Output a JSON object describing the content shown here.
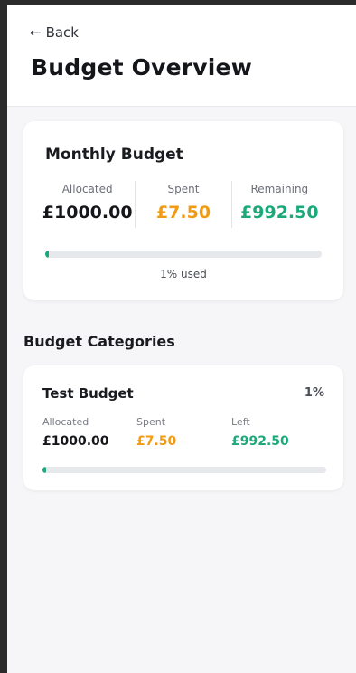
{
  "header": {
    "back_label": "Back",
    "title": "Budget Overview"
  },
  "monthly": {
    "title": "Monthly Budget",
    "stats": [
      {
        "label": "Allocated",
        "value": "£1000.00",
        "color": "#15161a"
      },
      {
        "label": "Spent",
        "value": "£7.50",
        "color": "#f19a13"
      },
      {
        "label": "Remaining",
        "value": "£992.50",
        "color": "#1ba97a"
      }
    ],
    "progress": 0.01,
    "used_text": "1% used"
  },
  "categories_section": {
    "title": "Budget Categories"
  },
  "categories": [
    {
      "name": "Test Budget",
      "percent": "1%",
      "allocated_label": "Allocated",
      "allocated_value": "£1000.00",
      "spent_label": "Spent",
      "spent_value": "£7.50",
      "left_label": "Left",
      "left_value": "£992.50",
      "progress": 0.01
    }
  ],
  "colors": {
    "accent_green": "#1ba97a",
    "accent_orange": "#f19a13",
    "track": "#e7e8ec"
  }
}
